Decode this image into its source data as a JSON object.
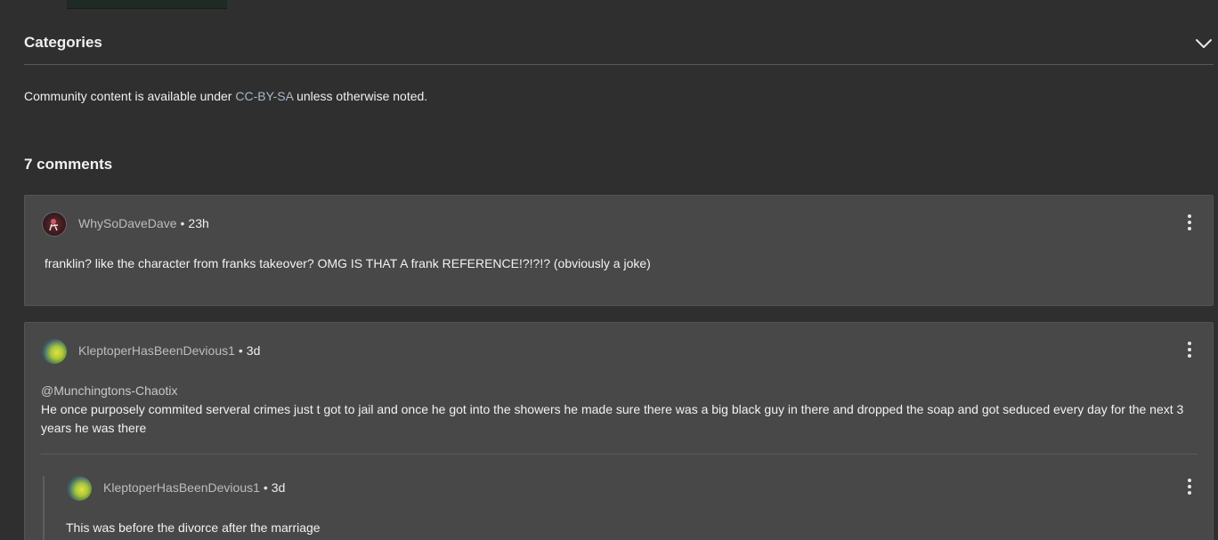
{
  "categories": {
    "title": "Categories",
    "chevron_icon": "chevron-down-icon"
  },
  "license": {
    "prefix": "Community content is available under ",
    "link_text": "CC-BY-SA",
    "suffix": " unless otherwise noted."
  },
  "comments": {
    "count_label": "7 comments",
    "items": [
      {
        "username": "WhySoDaveDave",
        "time": "23h",
        "text": "franklin? like the character from franks takeover? OMG IS THAT A frank REFERENCE!?!?!? (obviously a joke)"
      },
      {
        "username": "KleptoperHasBeenDevious1",
        "time": "3d",
        "mention": "@Munchingtons-Chaotix",
        "text": "He once purposely commited serveral crimes just t got to jail and once he got into the showers he made sure there was a big black guy in there and dropped the soap and got seduced every day for the next 3 years he was there",
        "reply": {
          "username": "KleptoperHasBeenDevious1",
          "time": "3d",
          "text": "This was before the divorce after the marriage"
        }
      }
    ]
  },
  "colors": {
    "background": "#2f2f2f",
    "card": "#484848",
    "link": "#a9b7c6"
  }
}
